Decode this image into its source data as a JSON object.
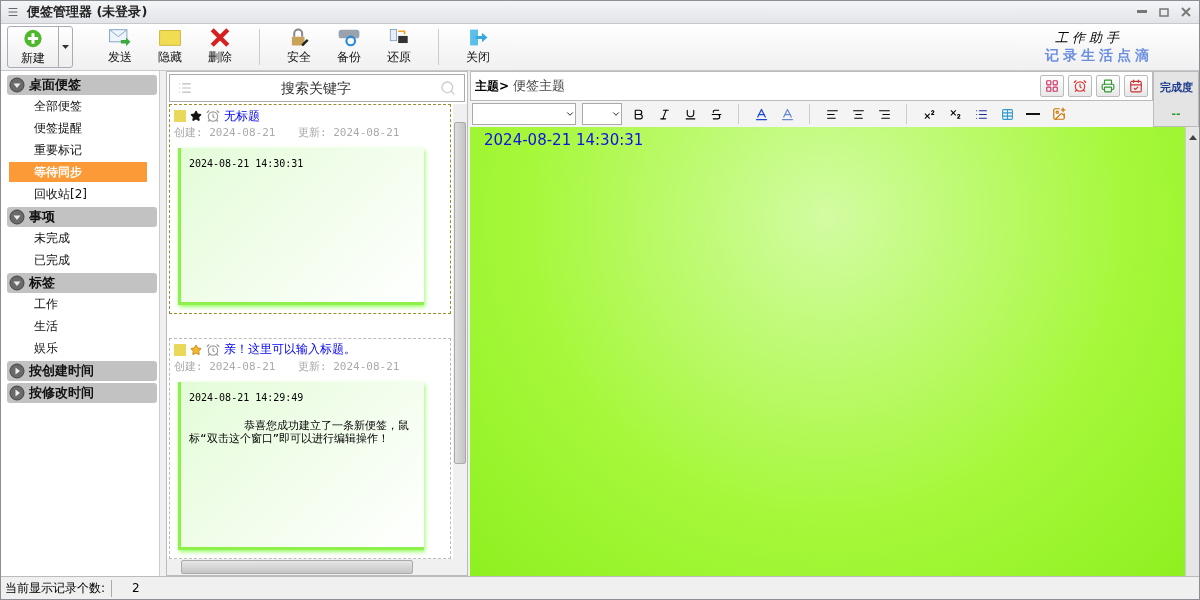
{
  "window": {
    "title": "便签管理器 (未登录)"
  },
  "toolbar": {
    "items": [
      {
        "kind": "new",
        "label": "新建",
        "has_dropdown": true
      },
      {
        "kind": "send",
        "label": "发送",
        "has_dropdown": false
      },
      {
        "kind": "hide",
        "label": "隐藏",
        "has_dropdown": false
      },
      {
        "kind": "delete",
        "label": "删除",
        "has_dropdown": false
      },
      {
        "kind": "security",
        "label": "安全",
        "has_dropdown": false
      },
      {
        "kind": "backup",
        "label": "备份",
        "has_dropdown": false
      },
      {
        "kind": "restore",
        "label": "还原",
        "has_dropdown": false
      },
      {
        "kind": "close",
        "label": "关闭",
        "has_dropdown": false
      }
    ],
    "logo": {
      "line_1": "工作助手",
      "line_2": "记录生活点滴"
    }
  },
  "sidebar": {
    "groups": [
      {
        "label": "桌面便签",
        "expanded": true,
        "items": [
          {
            "label": "全部便签",
            "selected": false
          },
          {
            "label": "便签提醒",
            "selected": false
          },
          {
            "label": "重要标记",
            "selected": false
          },
          {
            "label": "等待同步",
            "selected": true
          },
          {
            "label": "回收站[2]",
            "selected": false
          }
        ]
      },
      {
        "label": "事项",
        "expanded": true,
        "items": [
          {
            "label": "未完成",
            "selected": false
          },
          {
            "label": "已完成",
            "selected": false
          }
        ]
      },
      {
        "label": "标签",
        "expanded": true,
        "items": [
          {
            "label": "工作",
            "selected": false
          },
          {
            "label": "生活",
            "selected": false
          },
          {
            "label": "娱乐",
            "selected": false
          }
        ]
      },
      {
        "label": "按创建时间",
        "expanded": false
      },
      {
        "label": "按修改时间",
        "expanded": false
      }
    ]
  },
  "note_list": {
    "search": {
      "placeholder": "搜索关键字"
    },
    "notes": [
      {
        "title": "无标题",
        "selected": true,
        "important": false,
        "created_label": "创建:",
        "created": "2024-08-21",
        "updated_label": "更新:",
        "updated": "2024-08-21",
        "timestamp": "2024-08-21 14:30:31"
      },
      {
        "title": "亲！这里可以输入标题。",
        "selected": false,
        "important": true,
        "created_label": "创建:",
        "created": "2024-08-21",
        "updated_label": "更新:",
        "updated": "2024-08-21",
        "timestamp": "2024-08-21 14:29:49",
        "body": "恭喜您成功建立了一条新便签，鼠标“双击这个窗口”即可以进行编辑操作！"
      }
    ]
  },
  "editor": {
    "subject_label": "主题>",
    "subject": "便签主题",
    "completion_label": "完成度",
    "completion": "--",
    "content": "2024-08-21 14:30:31"
  },
  "status_bar": {
    "label": "当前显示记录个数:",
    "count": "2"
  }
}
